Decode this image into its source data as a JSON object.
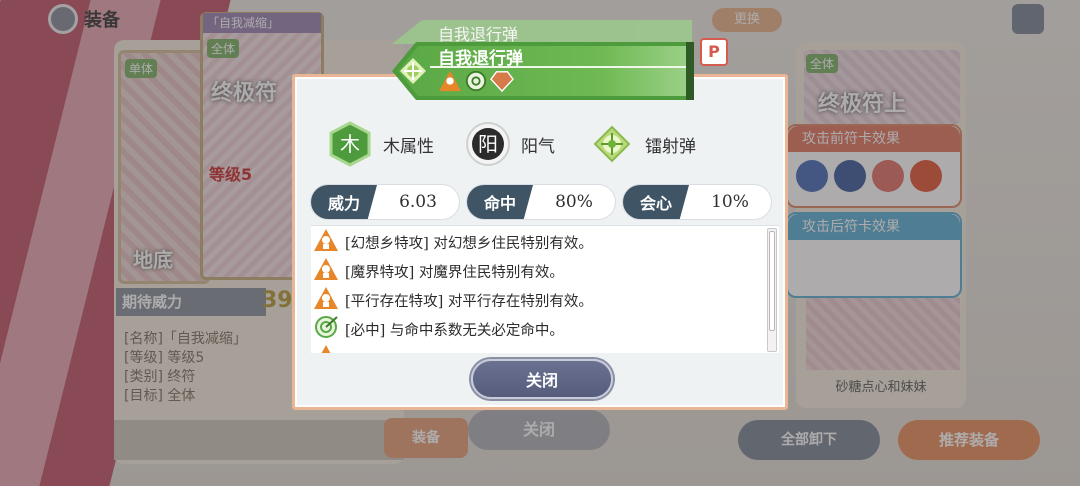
{
  "background": {
    "header_title": "装备",
    "swap_label": "更换",
    "card_left": {
      "tag": "单体",
      "big_text": "地底"
    },
    "card_main": {
      "name_tab": "「自我减缩」",
      "tag": "全体",
      "big_text": "终极符",
      "level_text": "等级5"
    },
    "expect_label": "期待威力",
    "expect_value": "39",
    "info_lines": [
      "[名称]「自我减缩」",
      "[等级] 等级5",
      "[类别] 终符",
      "[目标] 全体"
    ],
    "equip_label": "装备",
    "close_ghost_label": "关闭",
    "right_card": {
      "tag": "全体",
      "big_text": "终极符上"
    },
    "pre_effect_label": "攻击前符卡效果",
    "post_effect_label": "攻击后符卡效果",
    "right_card_name": "砂糖点心和妹妹",
    "unequip_all_label": "全部卸下",
    "recommend_label": "推荐装备"
  },
  "modal": {
    "banner_back_title": "自我退行弹",
    "banner_title": "自我退行弹",
    "p_badge": "P",
    "attributes": [
      {
        "icon": "wood-element-icon",
        "glyph": "木",
        "label": "木属性"
      },
      {
        "icon": "yang-qi-icon",
        "glyph": "阳",
        "label": "阳气"
      },
      {
        "icon": "radial-bullet-icon",
        "label": "镭射弹"
      }
    ],
    "stats": [
      {
        "label": "威力",
        "value": "6.03"
      },
      {
        "label": "命中",
        "value": "80%"
      },
      {
        "label": "会心",
        "value": "10%"
      }
    ],
    "traits": [
      {
        "icon": "special-attack-icon",
        "text": "[幻想乡特攻] 对幻想乡住民特别有效。"
      },
      {
        "icon": "special-attack-icon",
        "text": "[魔界特攻] 对魔界住民特别有效。"
      },
      {
        "icon": "special-attack-icon",
        "text": "[平行存在特攻] 对平行存在特别有效。"
      },
      {
        "icon": "sure-hit-icon",
        "text": "[必中] 与命中系数无关必定命中。"
      }
    ],
    "close_label": "关闭"
  },
  "colors": {
    "wood_green": "#4d9b3c",
    "stat_label_bg": "#3f5566",
    "special_attack_orange": "#e8872a",
    "modal_border": "#e9b594",
    "close_button": "#5e6584"
  }
}
